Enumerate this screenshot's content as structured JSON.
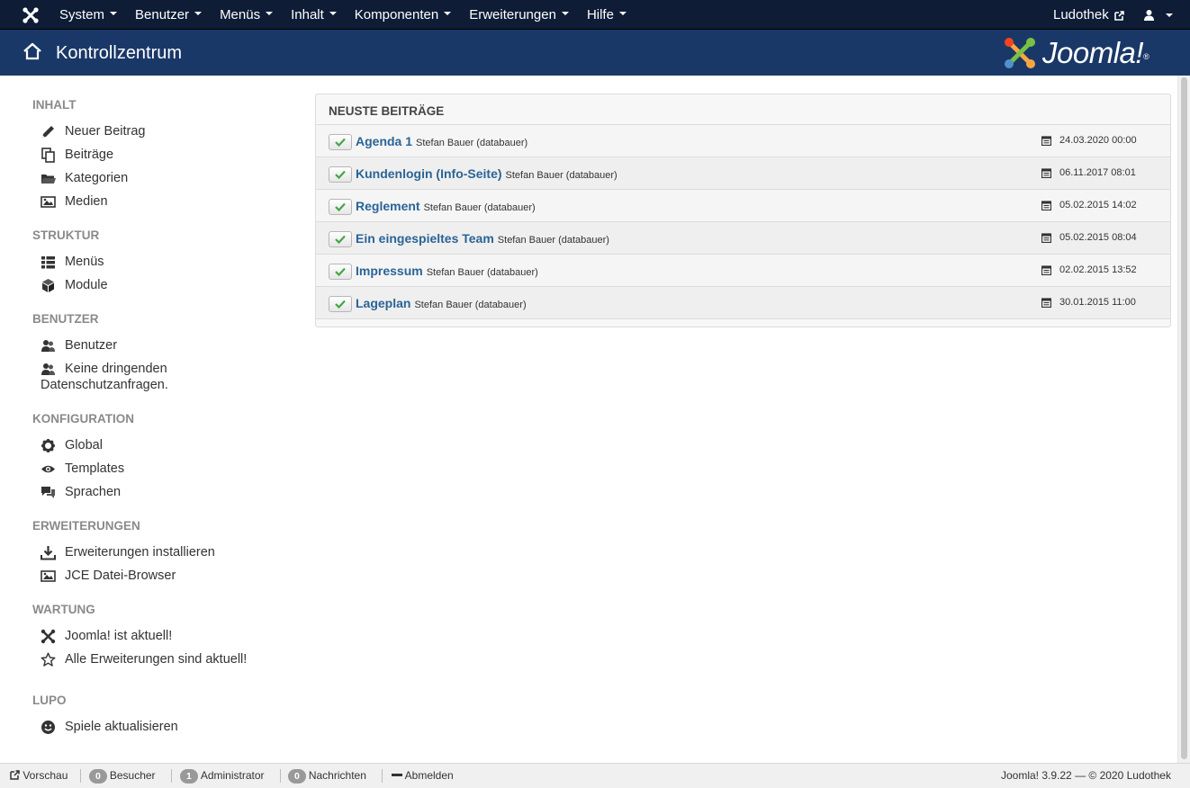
{
  "navbar": {
    "menu": [
      "System",
      "Benutzer",
      "Menüs",
      "Inhalt",
      "Komponenten",
      "Erweiterungen",
      "Hilfe"
    ],
    "site_name": "Ludothek"
  },
  "header": {
    "title": "Kontrollzentrum",
    "brand": "Joomla!",
    "brand_mark": "®"
  },
  "sidebar": {
    "sections": [
      {
        "heading": "INHALT",
        "items": [
          {
            "label": "Neuer Beitrag",
            "icon": "pencil-icon"
          },
          {
            "label": "Beiträge",
            "icon": "copy-icon"
          },
          {
            "label": "Kategorien",
            "icon": "folder-icon"
          },
          {
            "label": "Medien",
            "icon": "image-icon"
          }
        ]
      },
      {
        "heading": "STRUKTUR",
        "items": [
          {
            "label": "Menüs",
            "icon": "list-icon"
          },
          {
            "label": "Module",
            "icon": "cube-icon"
          }
        ]
      },
      {
        "heading": "BENUTZER",
        "items": [
          {
            "label": "Benutzer",
            "icon": "users-icon"
          },
          {
            "label": "Keine dringenden",
            "label2": "Datenschutzanfragen.",
            "icon": "users-icon"
          }
        ]
      },
      {
        "heading": "KONFIGURATION",
        "items": [
          {
            "label": "Global",
            "icon": "cog-icon"
          },
          {
            "label": "Templates",
            "icon": "eye-icon"
          },
          {
            "label": "Sprachen",
            "icon": "comments-icon"
          }
        ]
      },
      {
        "heading": "ERWEITERUNGEN",
        "items": [
          {
            "label": "Erweiterungen installieren",
            "icon": "download-icon"
          },
          {
            "label": "JCE Datei-Browser",
            "icon": "image-icon"
          }
        ]
      },
      {
        "heading": "WARTUNG",
        "items": [
          {
            "label": "Joomla! ist aktuell!",
            "icon": "joomla-icon"
          },
          {
            "label": "Alle Erweiterungen sind aktuell!",
            "icon": "star-icon"
          }
        ]
      },
      {
        "heading": "LUPO",
        "items": [
          {
            "label": "Spiele aktualisieren",
            "icon": "smiley-icon"
          }
        ]
      }
    ]
  },
  "panel": {
    "title": "NEUSTE BEITRÄGE",
    "rows": [
      {
        "title": "Agenda 1",
        "author": "Stefan Bauer (databauer)",
        "date": "24.03.2020 00:00"
      },
      {
        "title": "Kundenlogin (Info-Seite)",
        "author": "Stefan Bauer (databauer)",
        "date": "06.11.2017 08:01"
      },
      {
        "title": "Reglement",
        "author": "Stefan Bauer (databauer)",
        "date": "05.02.2015 14:02"
      },
      {
        "title": "Ein eingespieltes Team",
        "author": "Stefan Bauer (databauer)",
        "date": "05.02.2015 08:04"
      },
      {
        "title": "Impressum",
        "author": "Stefan Bauer (databauer)",
        "date": "02.02.2015 13:52"
      },
      {
        "title": "Lageplan",
        "author": "Stefan Bauer (databauer)",
        "date": "30.01.2015 11:00"
      }
    ]
  },
  "statusbar": {
    "preview": "Vorschau",
    "visitors_count": "0",
    "visitors_label": "Besucher",
    "admins_count": "1",
    "admins_label": "Administrator",
    "messages_count": "0",
    "messages_label": "Nachrichten",
    "logout": "Abmelden",
    "version": "Joomla! 3.9.22",
    "copyright": "— © 2020 Ludothek"
  },
  "colors": {
    "navbar": "#0e1c36",
    "header": "#1a3867",
    "link": "#2a6496",
    "check": "#46a546"
  }
}
